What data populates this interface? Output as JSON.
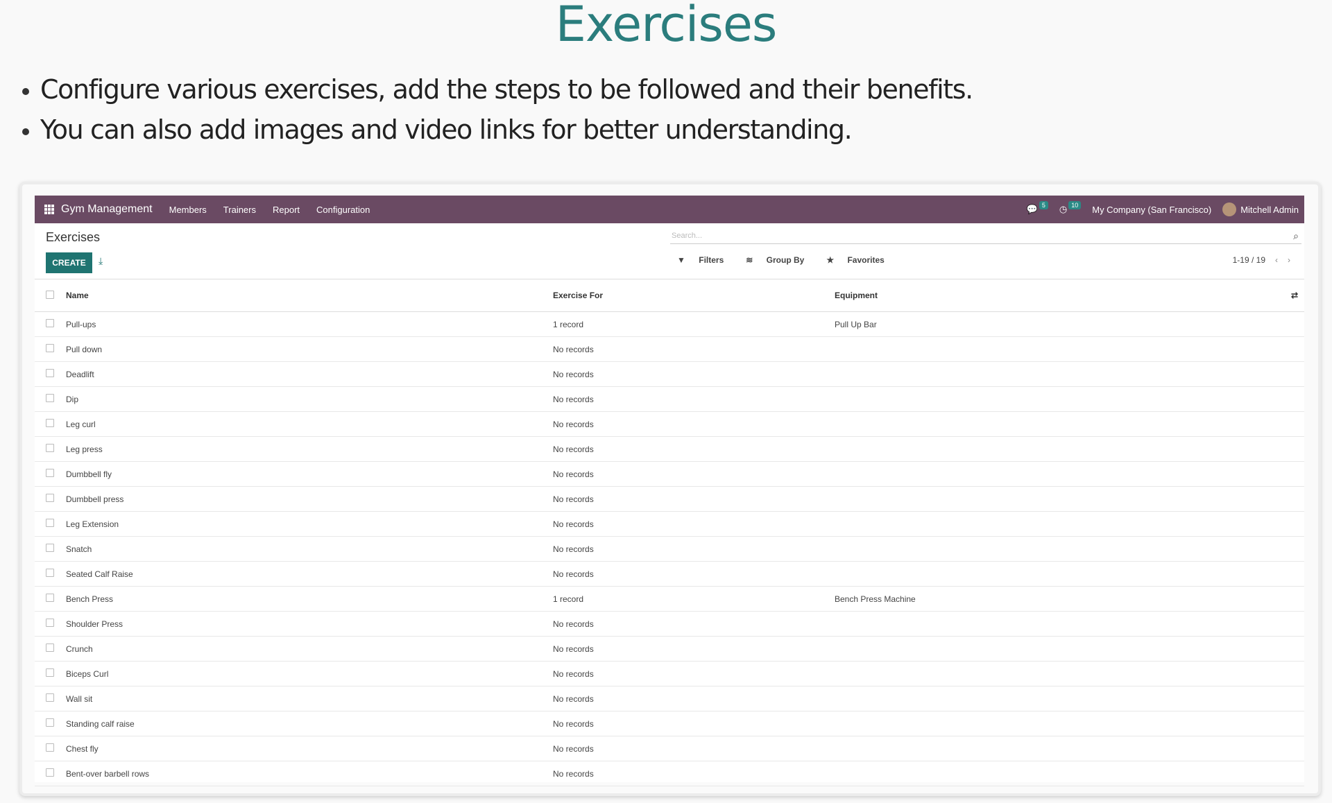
{
  "slide": {
    "title": "Exercises",
    "bullets": [
      "Configure various exercises, add the steps to be followed and their benefits.",
      "You can also add images and video links for better understanding."
    ]
  },
  "navbar": {
    "brand": "Gym Management",
    "menu": [
      "Members",
      "Trainers",
      "Report",
      "Configuration"
    ],
    "messages_count": "5",
    "activities_count": "10",
    "company": "My Company (San Francisco)",
    "user": "Mitchell Admin"
  },
  "control_panel": {
    "breadcrumb": "Exercises",
    "create_label": "CREATE",
    "search_placeholder": "Search...",
    "filters_label": "Filters",
    "groupby_label": "Group By",
    "favorites_label": "Favorites",
    "pager": "1-19 / 19"
  },
  "table": {
    "columns": [
      "Name",
      "Exercise For",
      "Equipment"
    ],
    "rows": [
      [
        "Pull-ups",
        "1 record",
        "Pull Up Bar"
      ],
      [
        "Pull down",
        "No records",
        ""
      ],
      [
        "Deadlift",
        "No records",
        ""
      ],
      [
        "Dip",
        "No records",
        ""
      ],
      [
        "Leg curl",
        "No records",
        ""
      ],
      [
        "Leg press",
        "No records",
        ""
      ],
      [
        "Dumbbell fly",
        "No records",
        ""
      ],
      [
        "Dumbbell press",
        "No records",
        ""
      ],
      [
        "Leg Extension",
        "No records",
        ""
      ],
      [
        "Snatch",
        "No records",
        ""
      ],
      [
        "Seated Calf Raise",
        "No records",
        ""
      ],
      [
        "Bench Press",
        "1 record",
        "Bench Press Machine"
      ],
      [
        "Shoulder Press",
        "No records",
        ""
      ],
      [
        "Crunch",
        "No records",
        ""
      ],
      [
        "Biceps Curl",
        "No records",
        ""
      ],
      [
        "Wall sit",
        "No records",
        ""
      ],
      [
        "Standing calf raise",
        "No records",
        ""
      ],
      [
        "Chest fly",
        "No records",
        ""
      ],
      [
        "Bent-over barbell rows",
        "No records",
        ""
      ]
    ]
  }
}
